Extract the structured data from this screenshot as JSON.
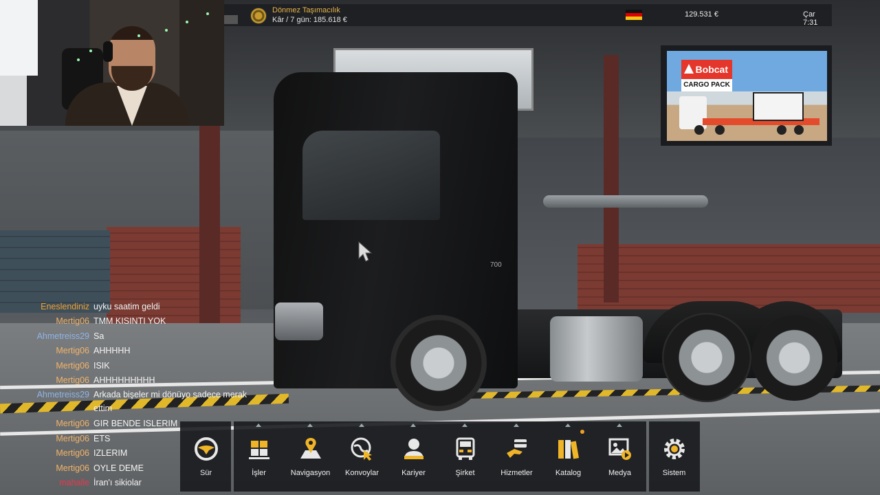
{
  "hud": {
    "company_name": "Dönmez Taşımacılık",
    "profit": "Kâr / 7 gün: 185.618 €",
    "money": "129.531 €",
    "time": "Çar 7:31",
    "flag": "germany-flag"
  },
  "ad": {
    "brand": "Bobcat",
    "title": "CARGO PACK"
  },
  "truck": {
    "badge": "700"
  },
  "chat": [
    {
      "user": "Eneslendiniz",
      "color": "#f0a030",
      "message": "uyku saatim geldi"
    },
    {
      "user": "Mertig06",
      "color": "#f2b36a",
      "message": "TMM KISINTI YOK"
    },
    {
      "user": "Ahmetreiss29",
      "color": "#8fb4e8",
      "message": "Sa"
    },
    {
      "user": "Mertig06",
      "color": "#f2b36a",
      "message": "AHHHHH"
    },
    {
      "user": "Mertig06",
      "color": "#f2b36a",
      "message": "ISIK"
    },
    {
      "user": "Mertig06",
      "color": "#f2b36a",
      "message": "AHHHHHHHHH"
    },
    {
      "user": "Ahmetreiss29",
      "color": "#8fb4e8",
      "message": "Arkada bişeler mi dönüyo sadece merak ettim"
    },
    {
      "user": "Mertig06",
      "color": "#f2b36a",
      "message": "GIR BENDE ISLERIM"
    },
    {
      "user": "Mertig06",
      "color": "#f2b36a",
      "message": "ETS"
    },
    {
      "user": "Mertig06",
      "color": "#f2b36a",
      "message": "IZLERIM"
    },
    {
      "user": "Mertig06",
      "color": "#f2b36a",
      "message": "OYLE DEME"
    },
    {
      "user": "mahalle",
      "color": "#e8384c",
      "message": "İran'ı sikiolar"
    }
  ],
  "menu": [
    {
      "label": "Sür",
      "icon": "steering-wheel-icon"
    },
    {
      "label": "İşler",
      "icon": "cargo-boxes-icon"
    },
    {
      "label": "Navigasyon",
      "icon": "map-pin-icon"
    },
    {
      "label": "Konvoylar",
      "icon": "globe-cursor-icon"
    },
    {
      "label": "Kariyer",
      "icon": "person-icon"
    },
    {
      "label": "Şirket",
      "icon": "truck-front-icon"
    },
    {
      "label": "Hizmetler",
      "icon": "hand-card-icon"
    },
    {
      "label": "Katalog",
      "icon": "books-icon"
    },
    {
      "label": "Medya",
      "icon": "media-icon"
    },
    {
      "label": "Sistem",
      "icon": "gear-icon"
    }
  ],
  "colors": {
    "accent": "#f0a020",
    "company": "#e8b54a"
  }
}
